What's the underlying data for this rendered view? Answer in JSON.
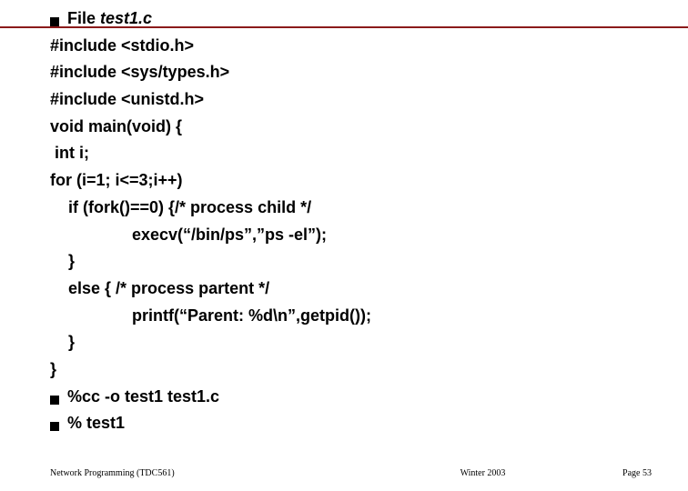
{
  "header": {
    "file_label": "File ",
    "file_name": "test1.c"
  },
  "code": {
    "l1": "#include <stdio.h>",
    "l2": "#include <sys/types.h>",
    "l3": "#include <unistd.h>",
    "l4": "void main(void) {",
    "l5": " int i;",
    "l6": "for (i=1; i<=3;i++)",
    "l7": "if (fork()==0) {/* process child */",
    "l8": "execv(“/bin/ps”,”ps -el”);",
    "l9": "}",
    "l10": "else { /* process partent */",
    "l11": "printf(“Parent: %d\\n”,getpid());",
    "l12": "}",
    "l13": "}"
  },
  "commands": {
    "compile": "%cc -o test1 test1.c",
    "run": "% test1"
  },
  "footer": {
    "left": "Network Programming (TDC561)",
    "center": "Winter  2003",
    "right": "Page 53"
  }
}
